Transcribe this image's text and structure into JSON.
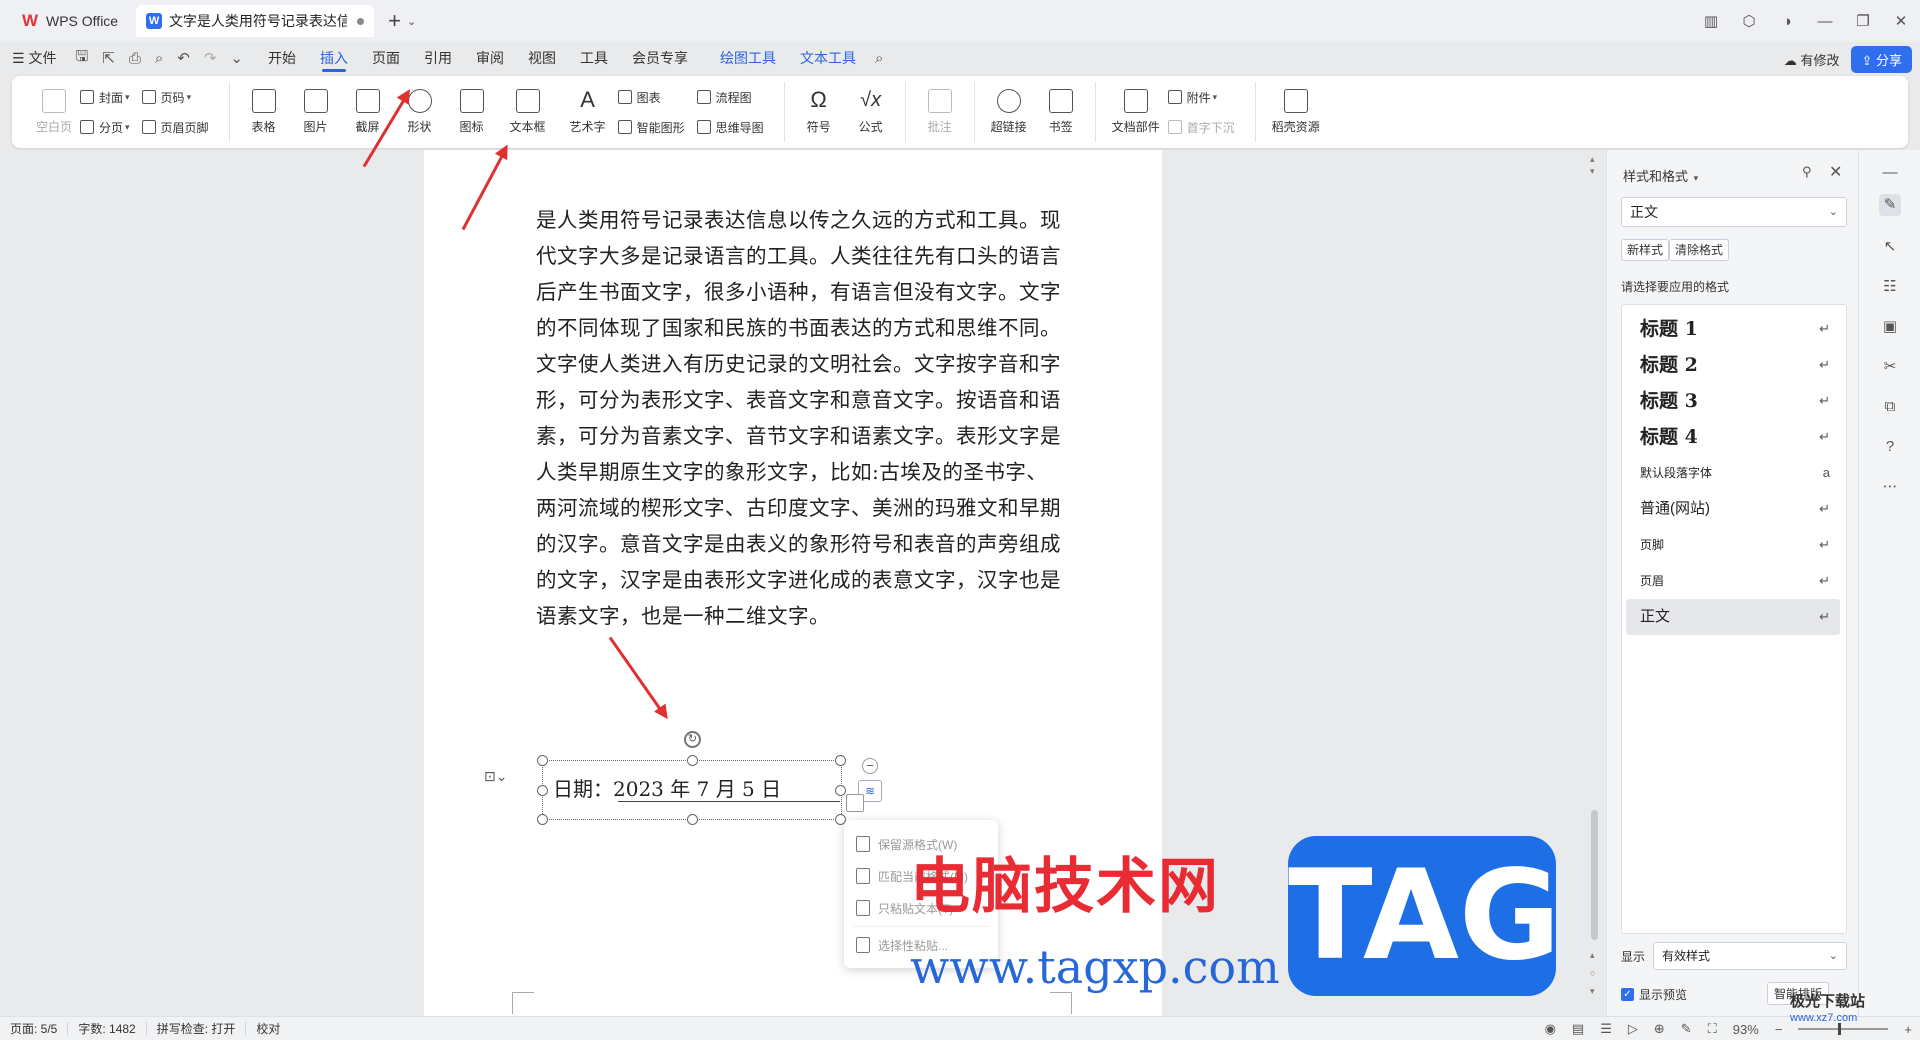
{
  "titlebar": {
    "wps_tab": "WPS Office",
    "doc_tab": "文字是人类用符号记录表达信息以传之久远的方式和工具"
  },
  "menubar": {
    "file": "文件",
    "items": [
      "开始",
      "插入",
      "页面",
      "引用",
      "审阅",
      "视图",
      "工具",
      "会员专享"
    ],
    "context_items": [
      "绘图工具",
      "文本工具"
    ],
    "active": "插入",
    "modify": "有修改",
    "share": "分享"
  },
  "ribbon": {
    "blank_page": "空白页",
    "cover": "封面",
    "page_break": "分页",
    "page_number": "页码",
    "header_footer": "页眉页脚",
    "table": "表格",
    "picture": "图片",
    "screenshot": "截屏",
    "shape": "形状",
    "icon": "图标",
    "textbox": "文本框",
    "wordart": "艺术字",
    "chart": "图表",
    "smart_graphic": "智能图形",
    "flowchart": "流程图",
    "mindmap": "思维导图",
    "symbol": "符号",
    "formula": "公式",
    "comment": "批注",
    "hyperlink": "超链接",
    "bookmark": "书签",
    "doc_parts": "文档部件",
    "attachment": "附件",
    "dropcap": "首字下沉",
    "resources": "稻壳资源"
  },
  "document": {
    "body": "是人类用符号记录表达信息以传之久远的方式和工具。现代文字大多是记录语言的工具。人类往往先有口头的语言后产生书面文字，很多小语种，有语言但没有文字。文字的不同体现了国家和民族的书面表达的方式和思维不同。文字使人类进入有历史记录的文明社会。文字按字音和字形，可分为表形文字、表音文字和意音文字。按语音和语素，可分为音素文字、音节文字和语素文字。表形文字是人类早期原生文字的象形文字，比如:古埃及的圣书字、两河流域的楔形文字、古印度文字、美洲的玛雅文和早期的汉字。意音文字是由表义的象形符号和表音的声旁组成的文字，汉字是由表形文字进化成的表意文字，汉字也是语素文字，也是一种二维文字。",
    "date_label": "日期：",
    "date_value": "2023 年 7 月 5 日"
  },
  "paste_menu": {
    "items": [
      "保留源格式(W)",
      "匹配当前格式(M)",
      "只粘贴文本(T)",
      "选择性粘贴..."
    ]
  },
  "style_panel": {
    "title": "样式和格式",
    "current_style": "正文",
    "new_style": "新样式",
    "clear_format": "清除格式",
    "choose_label": "请选择要应用的格式",
    "styles": [
      {
        "name": "标题  1",
        "kind": "heading"
      },
      {
        "name": "标题  2",
        "kind": "heading"
      },
      {
        "name": "标题  3",
        "kind": "heading"
      },
      {
        "name": "标题  4",
        "kind": "heading"
      },
      {
        "name": "默认段落字体",
        "kind": "small"
      },
      {
        "name": "普通(网站)",
        "kind": "medium"
      },
      {
        "name": "页脚",
        "kind": "small"
      },
      {
        "name": "页眉",
        "kind": "small"
      },
      {
        "name": "正文",
        "kind": "medium"
      }
    ],
    "selected_style": "正文",
    "show_label": "显示",
    "show_value": "有效样式",
    "preview_label": "显示预览",
    "smart_layout": "智能排版"
  },
  "statusbar": {
    "page": "页面: 5/5",
    "words": "字数: 1482",
    "spell": "拼写检查: 打开",
    "proof": "校对",
    "zoom": "93%"
  },
  "watermark": {
    "text": "电脑技术网",
    "url": "www.tagxp.com",
    "tag": "TAG",
    "site": "极光下载站",
    "site_url": "www.xz7.com"
  },
  "colors": {
    "accent": "#2b65d9",
    "annotation_arrow": "#e03030"
  }
}
